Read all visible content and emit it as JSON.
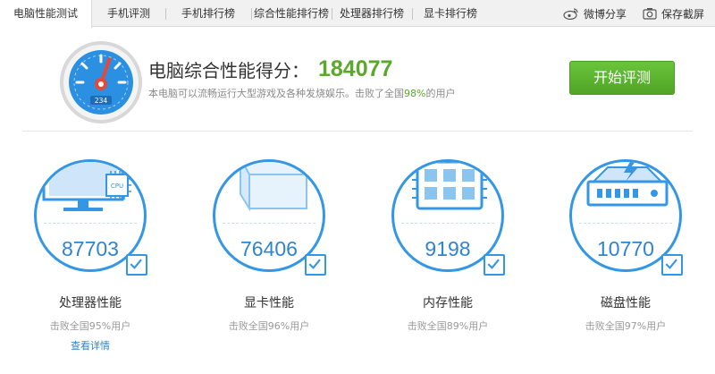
{
  "tabs": [
    {
      "label": "电脑性能测试",
      "active": true
    },
    {
      "label": "手机评测",
      "active": false
    },
    {
      "label": "手机排行榜",
      "active": false
    },
    {
      "label": "综合性能排行榜",
      "active": false
    },
    {
      "label": "处理器排行榜",
      "active": false
    },
    {
      "label": "显卡排行榜",
      "active": false
    }
  ],
  "tools": {
    "weibo_share": "微博分享",
    "screenshot": "保存截屏",
    "weibo_icon": "weibo-icon",
    "camera_icon": "camera-icon"
  },
  "summary": {
    "title": "电脑综合性能得分：",
    "score": "184077",
    "desc_prefix": "本电脑可以流畅运行大型游戏及各种发烧娱乐。击败了全国",
    "desc_percent": "98%",
    "desc_suffix": "的用户",
    "gauge_counter": "234",
    "start_button": "开始评测"
  },
  "cards": [
    {
      "icon": "monitor-cpu-icon",
      "chip_text": "CPU",
      "score": "87703",
      "title": "处理器性能",
      "subtitle": "击败全国95%用户",
      "link": "查看详情"
    },
    {
      "icon": "graphics-card-icon",
      "score": "76406",
      "title": "显卡性能",
      "subtitle": "击败全国96%用户"
    },
    {
      "icon": "memory-chip-icon",
      "score": "9198",
      "title": "内存性能",
      "subtitle": "击败全国89%用户"
    },
    {
      "icon": "hard-disk-icon",
      "score": "10770",
      "title": "磁盘性能",
      "subtitle": "击败全国97%用户"
    }
  ],
  "colors": {
    "accent_blue": "#3497e6",
    "score_green": "#5aa92a",
    "button_green": "#5cb52e"
  }
}
